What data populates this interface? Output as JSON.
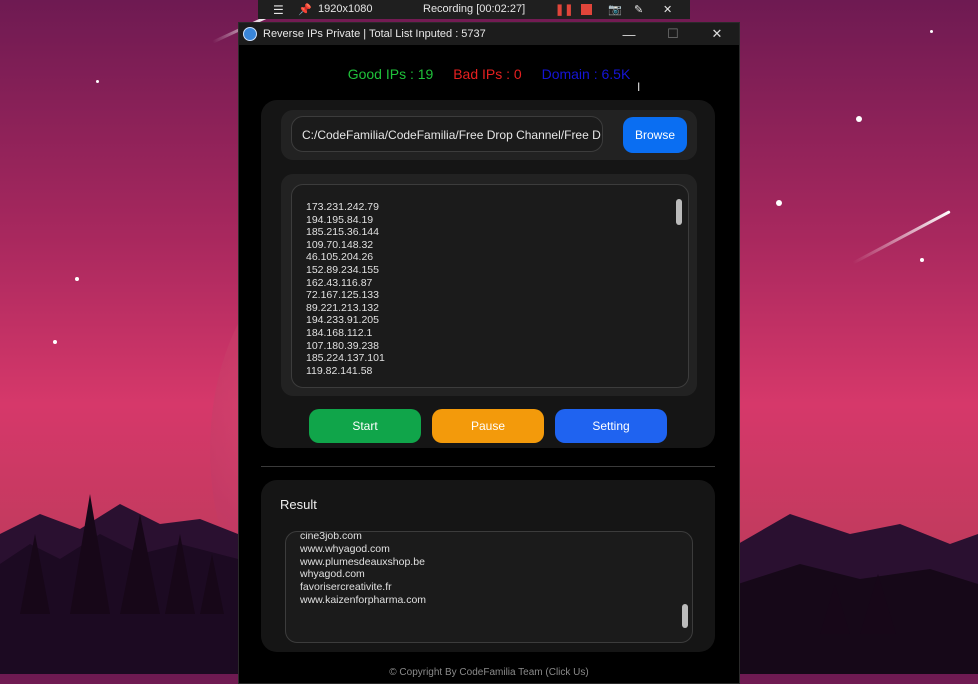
{
  "recorder": {
    "resolution": "1920x1080",
    "status": "Recording [00:02:27]"
  },
  "window": {
    "title": "Reverse IPs Private | Total List Inputed : 5737"
  },
  "stats": {
    "good": "Good IPs : 19",
    "bad": "Bad IPs : 0",
    "domain": "Domain : 6.5K",
    "colors": {
      "good": "#1fc23a",
      "bad": "#e62020",
      "domain": "#1515d6"
    }
  },
  "path": {
    "value": "C:/CodeFamilia/CodeFamilia/Free Drop Channel/Free D",
    "browse_label": "Browse"
  },
  "ip_list": [
    "173.231.242.79",
    "194.195.84.19",
    "185.215.36.144",
    "109.70.148.32",
    "46.105.204.26",
    "152.89.234.155",
    "162.43.116.87",
    "72.167.125.133",
    "89.221.213.132",
    "194.233.91.205",
    "184.168.112.1",
    "107.180.39.238",
    "185.224.137.101",
    "119.82.141.58"
  ],
  "buttons": {
    "start": "Start",
    "pause": "Pause",
    "setting": "Setting"
  },
  "result": {
    "title": "Result",
    "items": [
      "cine3job.com",
      "www.whyagod.com",
      "www.plumesdeauxshop.be",
      "whyagod.com",
      "favorisercreativite.fr",
      "www.kaizenforpharma.com"
    ]
  },
  "footer": {
    "copyright": "© Copyright By CodeFamilia Team (Click Us)"
  },
  "icons": [
    "menu-icon",
    "pin-icon",
    "pause-icon",
    "stop-icon",
    "camera-icon",
    "pen-icon",
    "close-icon",
    "app-icon",
    "minimize-icon",
    "maximize-icon"
  ]
}
